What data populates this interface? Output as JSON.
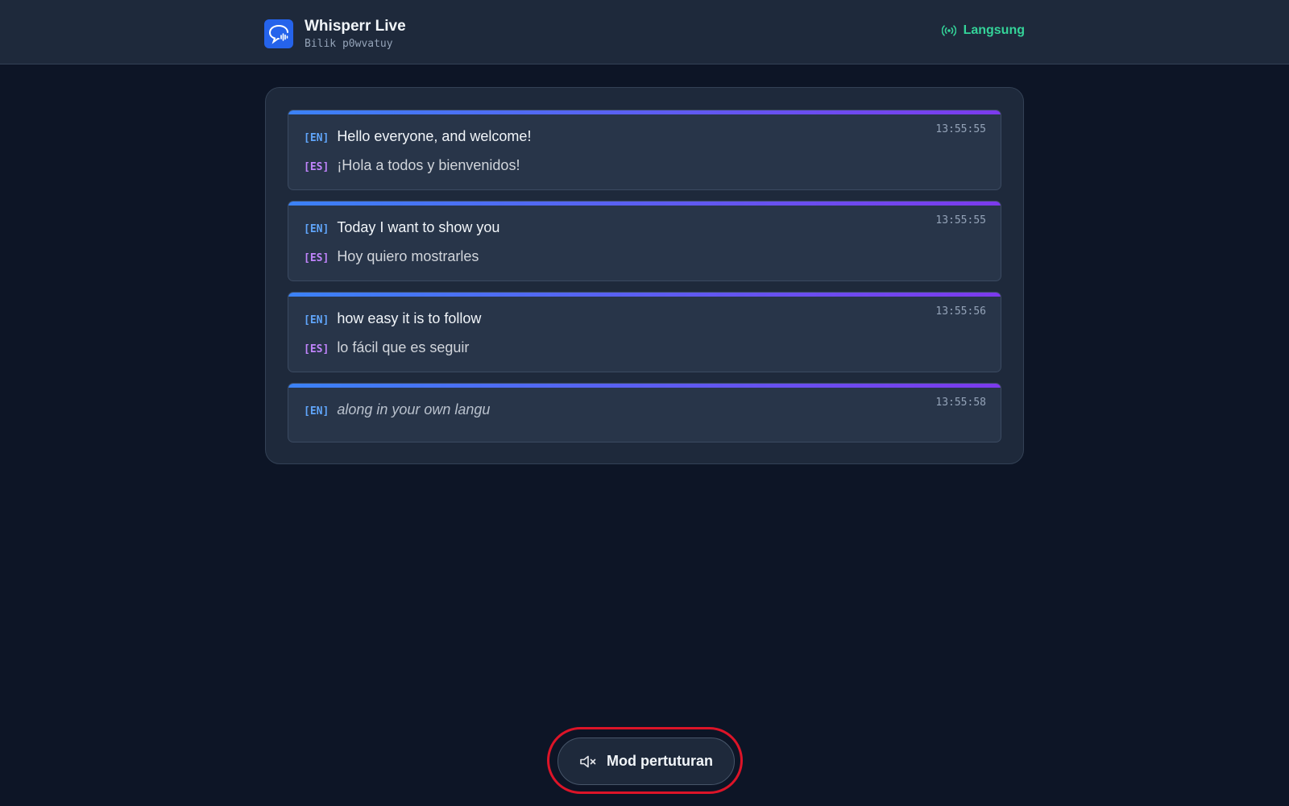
{
  "header": {
    "app_title": "Whisperr Live",
    "room_name": "Bilik p0wvatuy",
    "status_label": "Langsung",
    "status_color": "#34d399",
    "logo_icon": "speech-bubble-waveform-icon",
    "status_icon": "broadcast-icon"
  },
  "transcript": {
    "entries": [
      {
        "time": "13:55:55",
        "en_tag": "[EN]",
        "en_text": "Hello everyone, and welcome!",
        "es_tag": "[ES]",
        "es_text": "¡Hola a todos y bienvenidos!"
      },
      {
        "time": "13:55:55",
        "en_tag": "[EN]",
        "en_text": "Today I want to show you",
        "es_tag": "[ES]",
        "es_text": "Hoy quiero mostrarles"
      },
      {
        "time": "13:55:56",
        "en_tag": "[EN]",
        "en_text": "how easy it is to follow",
        "es_tag": "[ES]",
        "es_text": "lo fácil que es seguir"
      },
      {
        "time": "13:55:58",
        "en_tag": "[EN]",
        "en_text": "along in your own langu"
      }
    ]
  },
  "footer": {
    "disturb_label": "Mod pertuturan",
    "disturb_icon": "speaker-muted-icon",
    "highlight_color": "#dc1428"
  },
  "colors": {
    "background": "#0d1526",
    "panel": "#1e293b",
    "en_tag": "#60a5fa",
    "es_tag": "#c084fc",
    "accent_gradient_start": "#3b82f6",
    "accent_gradient_end": "#7c3aed"
  }
}
